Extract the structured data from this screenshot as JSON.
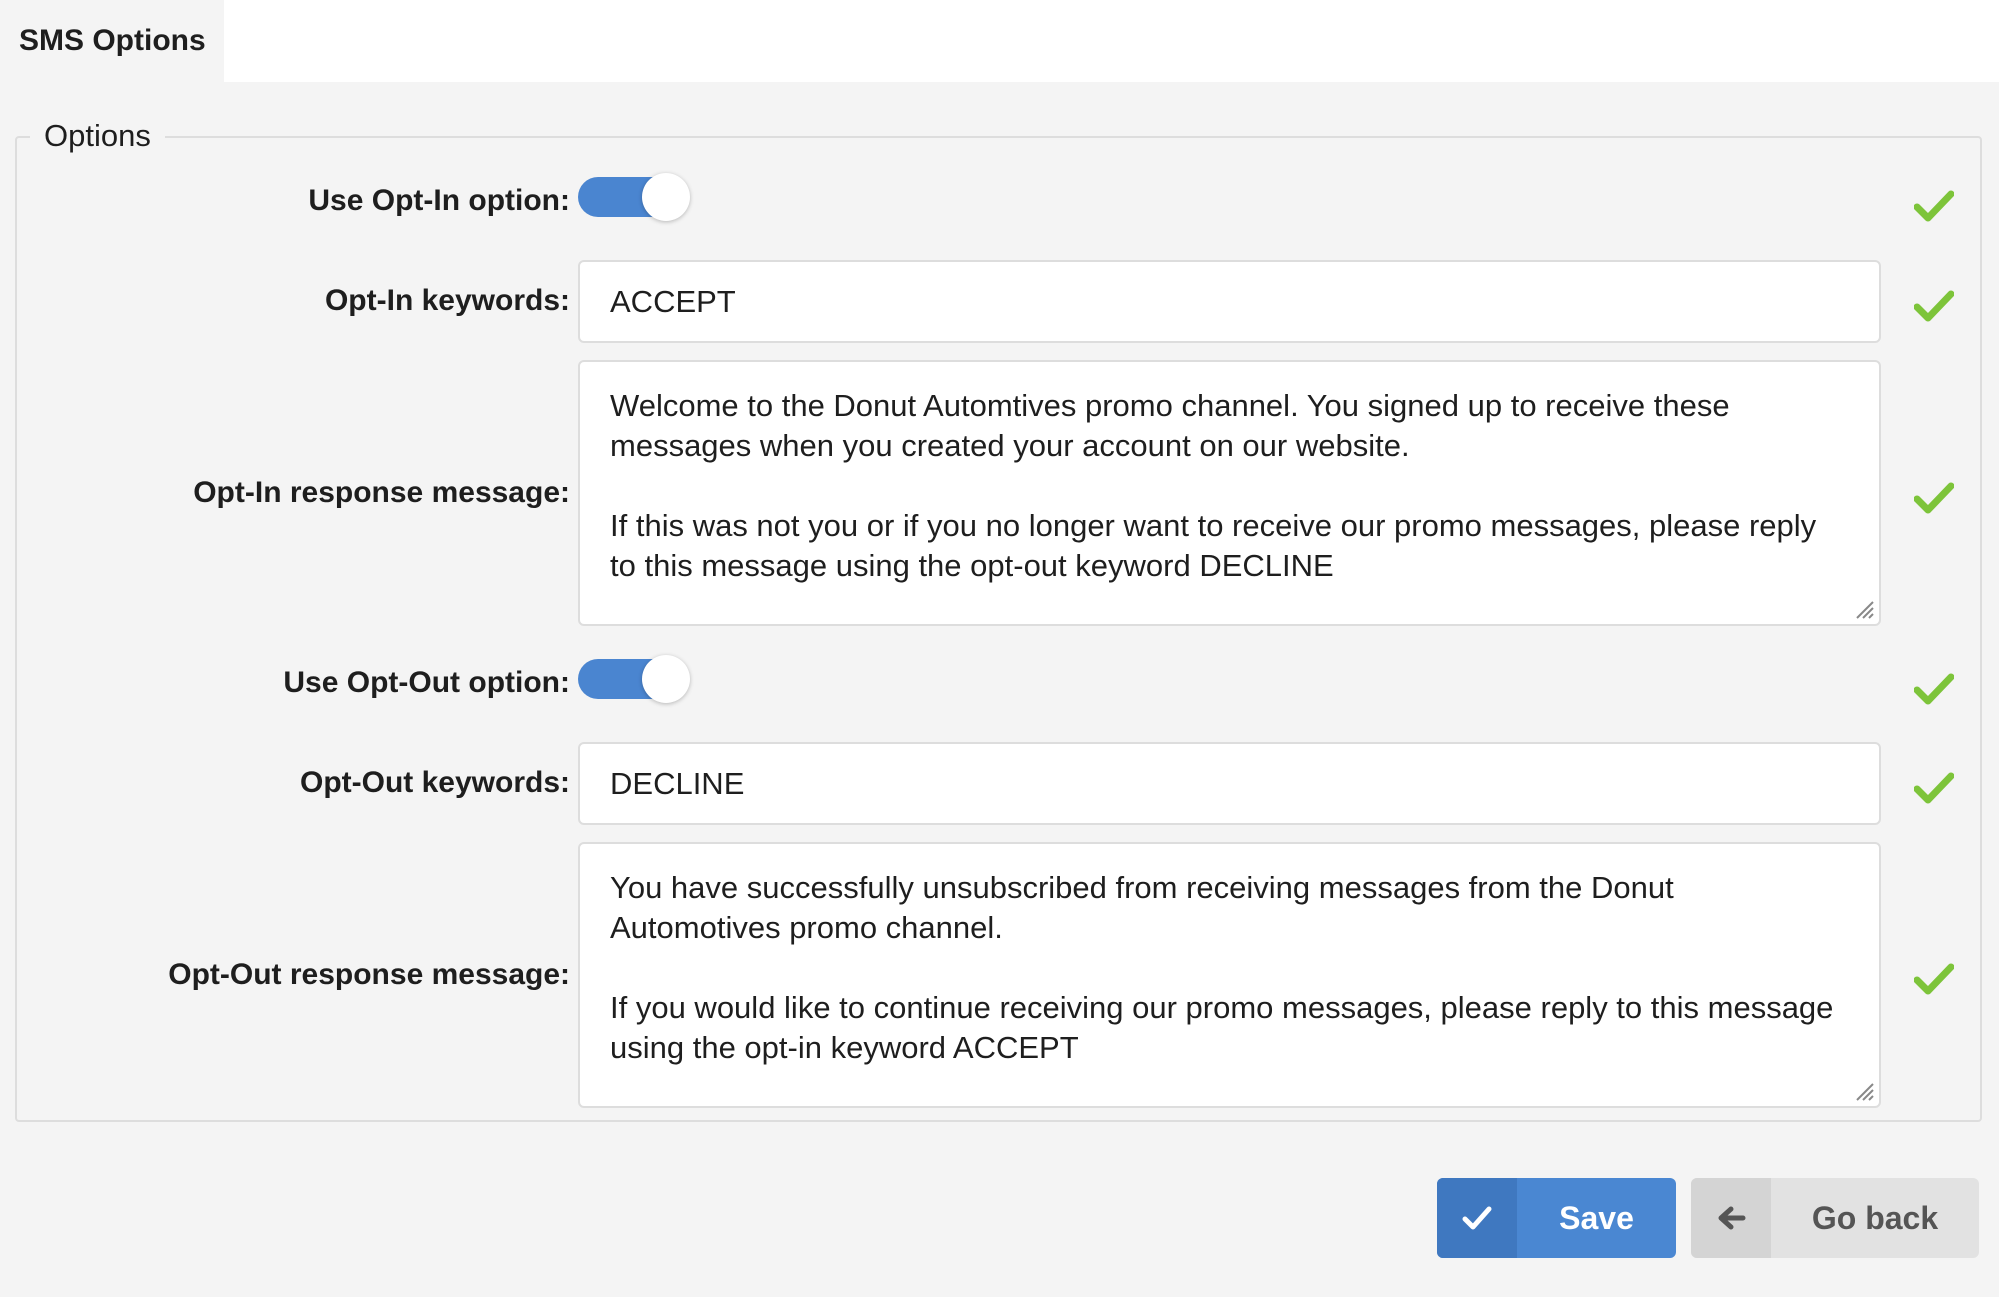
{
  "tab": {
    "label": "SMS Options"
  },
  "fieldset": {
    "legend": "Options"
  },
  "fields": {
    "use_opt_in": {
      "label": "Use Opt-In option:",
      "enabled": true
    },
    "opt_in_keywords": {
      "label": "Opt-In keywords:",
      "value": "ACCEPT"
    },
    "opt_in_response": {
      "label": "Opt-In response message:",
      "paragraph1": "Welcome to the Donut Automtives promo channel. You signed up to receive these messages when you created your account on our website.",
      "paragraph2": "If this was not you or if you no longer want to receive our promo messages, please reply to this message using the opt-out keyword DECLINE"
    },
    "use_opt_out": {
      "label": "Use Opt-Out option:",
      "enabled": true
    },
    "opt_out_keywords": {
      "label": "Opt-Out keywords:",
      "value": "DECLINE"
    },
    "opt_out_response": {
      "label": "Opt-Out response message:",
      "paragraph1": "You have successfully unsubscribed from receiving messages from the Donut Automotives promo channel.",
      "paragraph2": "If you would like to continue receiving our promo messages, please reply to this message using the opt-in keyword ACCEPT"
    }
  },
  "buttons": {
    "save_label": "Save",
    "back_label": "Go back"
  },
  "colors": {
    "accent": "#4a87d2",
    "valid_check": "#7dc43a",
    "page_background": "#f4f4f4",
    "secondary_button": "#e2e2e2"
  },
  "icons": {
    "valid": "check-icon",
    "save": "check-icon",
    "back": "arrow-left-icon",
    "resize": "resize-handle-icon"
  }
}
